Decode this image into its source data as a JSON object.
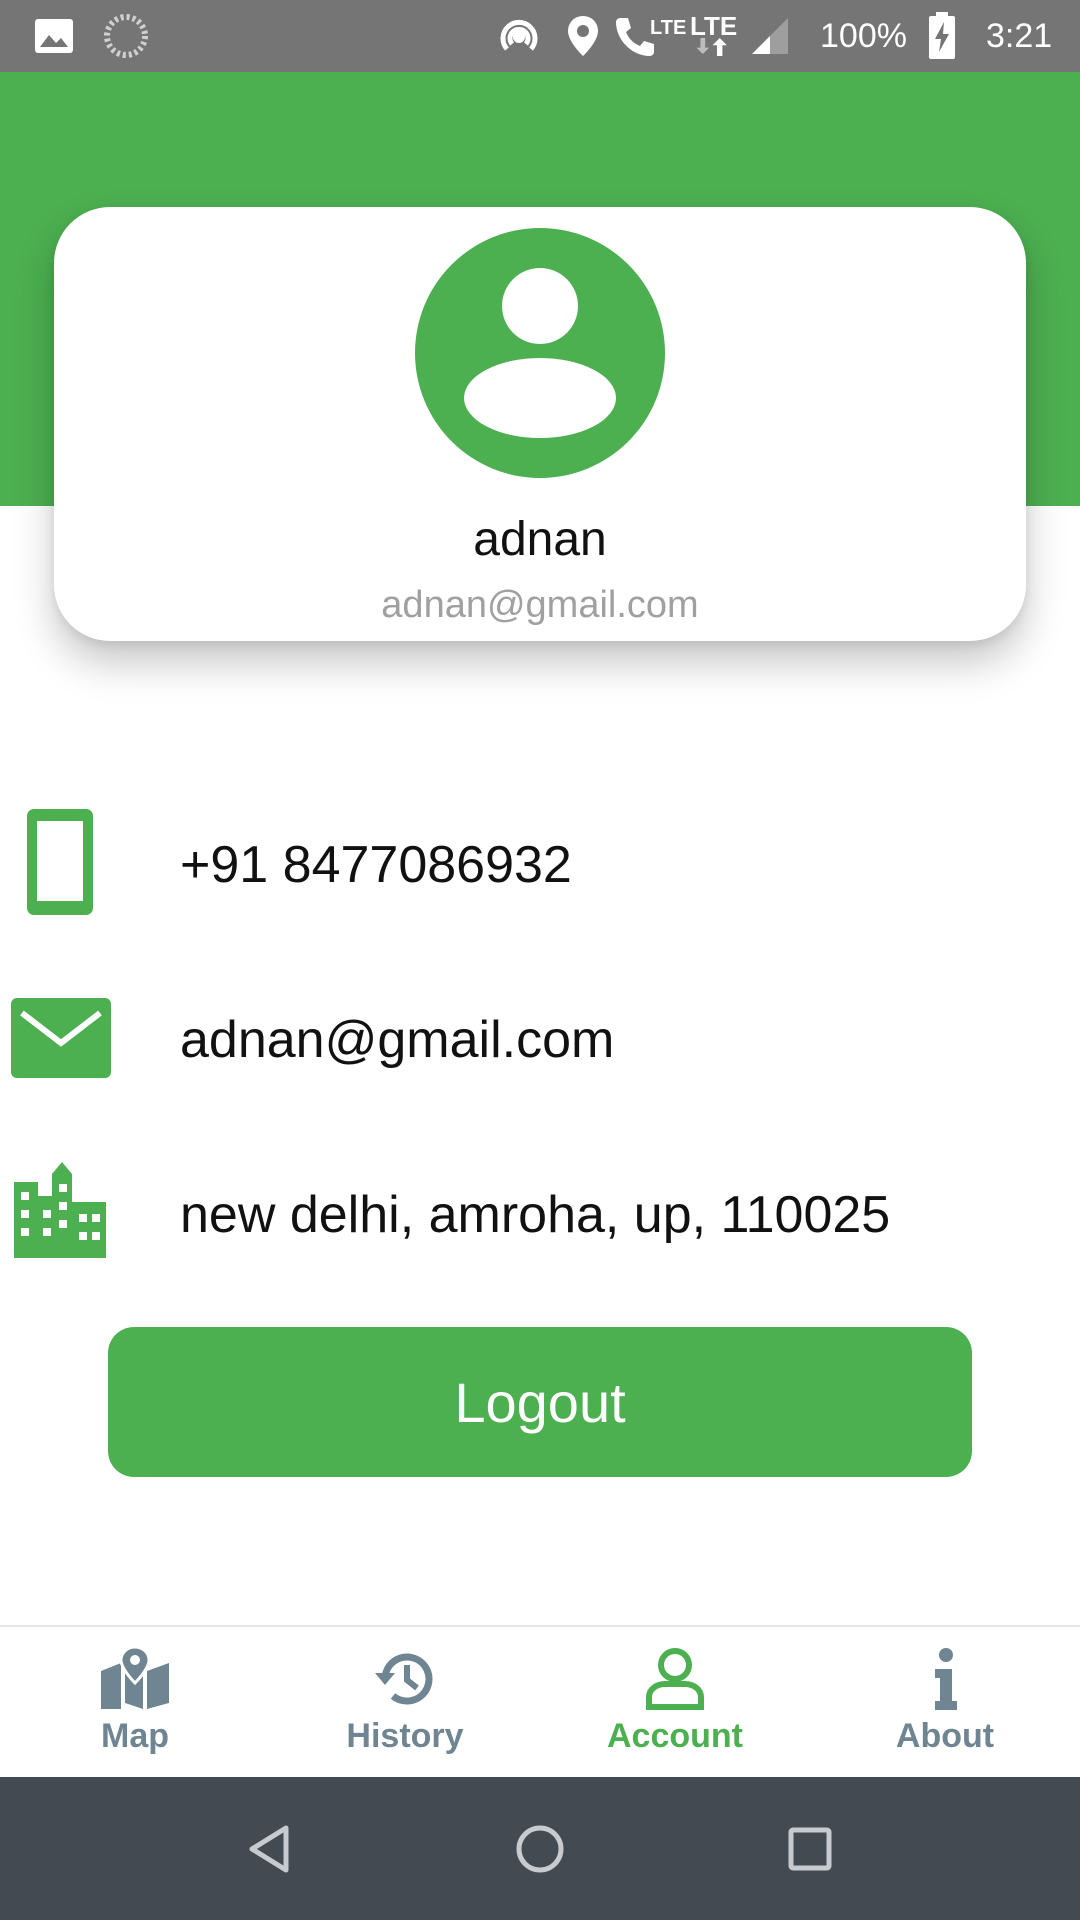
{
  "status_bar": {
    "battery": "100%",
    "time": "3:21",
    "network_labels": [
      "LTE",
      "LTE"
    ]
  },
  "profile": {
    "name": "adnan",
    "email": "adnan@gmail.com"
  },
  "info": {
    "phone": "+91 8477086932",
    "email": "adnan@gmail.com",
    "address": "new delhi, amroha, up, 110025"
  },
  "actions": {
    "logout_label": "Logout"
  },
  "bottom_nav": {
    "items": [
      {
        "label": "Map",
        "icon": "map-icon",
        "active": false
      },
      {
        "label": "History",
        "icon": "history-icon",
        "active": false
      },
      {
        "label": "Account",
        "icon": "account-icon",
        "active": true
      },
      {
        "label": "About",
        "icon": "info-icon",
        "active": false
      }
    ]
  },
  "colors": {
    "primary": "#4caf50",
    "nav_inactive": "#6f8591",
    "status_bar": "#757575",
    "system_nav": "#434a51"
  }
}
